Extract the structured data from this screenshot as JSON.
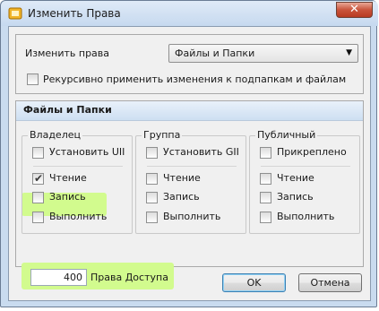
{
  "window": {
    "title": "Изменить Права",
    "close_symbol": "✕"
  },
  "top": {
    "change_label": "Изменить права",
    "combo_value": "Файлы и Папки",
    "recursive_label": "Рекурсивно применить изменения к подпапкам и файлам",
    "recursive_checked": false
  },
  "section": {
    "title": "Файлы и Папки"
  },
  "groups": {
    "owner": {
      "title": "Владелец",
      "setuid": {
        "label": "Установить UII",
        "checked": false
      },
      "read": {
        "label": "Чтение",
        "checked": true
      },
      "write": {
        "label": "Запись",
        "checked": false
      },
      "execute": {
        "label": "Выполнить",
        "checked": false
      }
    },
    "group": {
      "title": "Группа",
      "setgid": {
        "label": "Установить GII",
        "checked": false
      },
      "read": {
        "label": "Чтение",
        "checked": false
      },
      "write": {
        "label": "Запись",
        "checked": false
      },
      "execute": {
        "label": "Выполнить",
        "checked": false
      }
    },
    "public": {
      "title": "Публичный",
      "sticky": {
        "label": "Прикреплено",
        "checked": false
      },
      "read": {
        "label": "Чтение",
        "checked": false
      },
      "write": {
        "label": "Запись",
        "checked": false
      },
      "execute": {
        "label": "Выполнить",
        "checked": false
      }
    }
  },
  "permissions": {
    "value": "400",
    "label": "Права Доступа"
  },
  "buttons": {
    "ok": "OK",
    "cancel": "Отмена"
  },
  "colors": {
    "highlight": "#d2fb8e",
    "titlebar": "#c6d9ef",
    "close": "#c9543b"
  }
}
